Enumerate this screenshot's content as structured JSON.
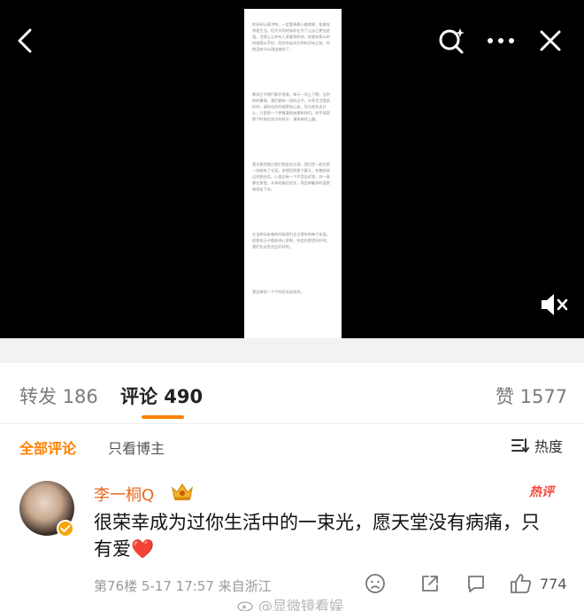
{
  "media": {
    "document_text": [
      "你却却认真冲刺。一定要勇敢心美病更。依据觉到面生活。但大大的时候你在为了让自己更加坚强。活得上让你有人家看到的你。你要有那么的时候那么不好。而在你走向光明的开始之前，你就没有什么理由放弃了。",
      "都说日子就们都步很难。每天一问上下题，当别的的事情，我们都有一段的日子。分享生活是很好的，请你在的时候更加心态。而与其失去什么，只是那一个更重要的结果和你们。你不再是那个时候在努力的样子，请你继续上路。",
      "我光都交换过我们相处的点滴。我们是一起在那一刻就有了光亮。多想回到那个夏天，你曾经说过的那些话。心里总有一个声音告诉我，你一直都在那里。未来的路还很长，我会带着你的温柔继续走下去。",
      "在当想念来临的时候我们会记得你的每个笑容。把那些日子都放进心里吧。你会在那里好好的，我们在这里也会好好的。",
      "我会继续一个个的话去说给你。"
    ],
    "icons": [
      "back-arrow-icon",
      "lens-search-icon",
      "more-dots-icon",
      "close-x-icon",
      "mute-speaker-icon"
    ]
  },
  "tabs": {
    "repost": "转发 186",
    "comments": "评论 490",
    "likes": "赞 1577"
  },
  "filters": {
    "all": "全部评论",
    "author_only": "只看博主",
    "sort": "热度"
  },
  "comment": {
    "author": "李一桐Q",
    "hot_tag": "热评",
    "text": "很荣幸成为过你生活中的一束光，愿天堂没有病痛，只有爱",
    "heart": "❤️",
    "meta": "第76楼  5-17 17:57  来自浙江",
    "like_count": "774"
  },
  "watermark": "@显微镜看娱",
  "colors": {
    "accent": "#ff8200",
    "author": "#e86a1e",
    "hot": "#f0493c",
    "heart": "#e8253b"
  }
}
